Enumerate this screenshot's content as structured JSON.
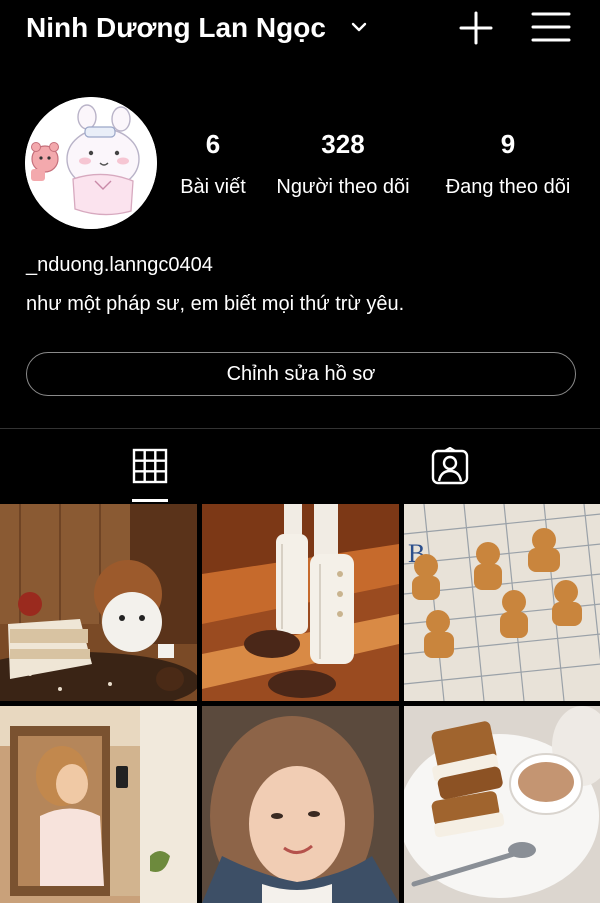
{
  "header": {
    "username": "Ninh Dương Lan Ngọc"
  },
  "stats": {
    "posts": {
      "count": "6",
      "label": "Bài viết"
    },
    "followers": {
      "count": "328",
      "label": "Người theo dõi"
    },
    "following": {
      "count": "9",
      "label": "Đang theo dõi"
    }
  },
  "profile": {
    "handle": "_nduong.lanngc0404",
    "bio": "như một pháp sư, em biết mọi thứ trừ yêu."
  },
  "actions": {
    "edit_profile": "Chỉnh sửa hồ sơ"
  },
  "icons": {
    "dropdown": "chevron-down-icon",
    "create": "plus-icon",
    "menu": "hamburger-menu-icon",
    "grid_tab": "grid-icon",
    "tagged_tab": "tagged-person-icon"
  },
  "grid_posts": [
    {
      "description": "cake-with-bear-plush"
    },
    {
      "description": "leg-warmers-shoes"
    },
    {
      "description": "gingerbread-cookies"
    },
    {
      "description": "mirror-selfie"
    },
    {
      "description": "portrait-selfie"
    },
    {
      "description": "biscoff-sandwich-coffee"
    }
  ],
  "colors": {
    "background": "#000000",
    "text": "#ffffff",
    "border": "#8a8a8a"
  }
}
